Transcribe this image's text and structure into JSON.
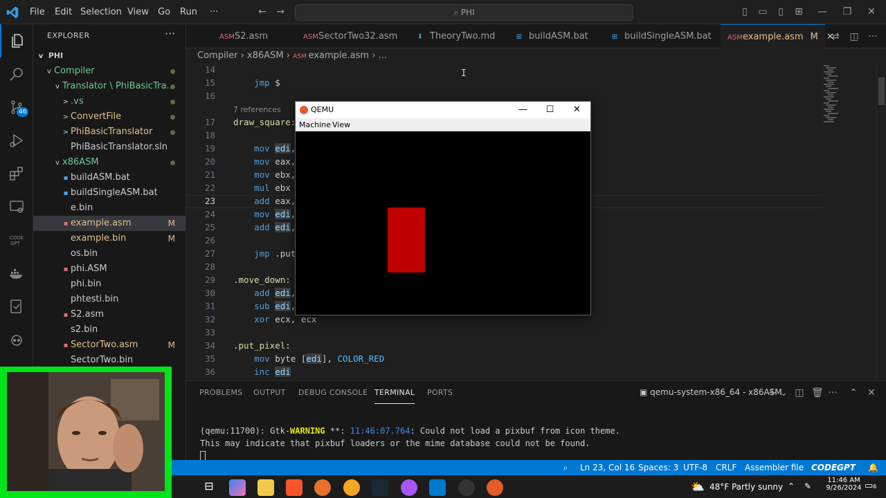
{
  "titlebar": {
    "menus": [
      "File",
      "Edit",
      "Selection",
      "View",
      "Go",
      "Run",
      "···"
    ],
    "search": "PHI"
  },
  "activity": {
    "source_control_badge": "46"
  },
  "explorer": {
    "title": "EXPLORER",
    "root": "PHI",
    "items": [
      {
        "label": "Compiler",
        "color": "#73c991",
        "chev": "v",
        "indent": 0,
        "status": "dot"
      },
      {
        "label": "Translator \\ PhiBasicTra...",
        "color": "#73c991",
        "chev": "v",
        "indent": 1,
        "status": "dot"
      },
      {
        "label": ".vs",
        "color": "#73c991",
        "chev": ">",
        "indent": 2,
        "status": "dot"
      },
      {
        "label": "ConvertFile",
        "color": "#e2c08d",
        "chev": ">",
        "indent": 2,
        "status": "dot"
      },
      {
        "label": "PhiBasicTranslator",
        "color": "#e2c08d",
        "chev": ">",
        "indent": 2,
        "status": "dot"
      },
      {
        "label": "PhiBasicTranslator.sln",
        "color": "#cccccc",
        "chev": "",
        "indent": 2,
        "status": ""
      },
      {
        "label": "x86ASM",
        "color": "#73c991",
        "chev": "v",
        "indent": 1,
        "status": "dot"
      },
      {
        "label": "buildASM.bat",
        "color": "#cccccc",
        "chev": "",
        "indent": 2,
        "status": ""
      },
      {
        "label": "buildSingleASM.bat",
        "color": "#cccccc",
        "chev": "",
        "indent": 2,
        "status": ""
      },
      {
        "label": "e.bin",
        "color": "#cccccc",
        "chev": "",
        "indent": 2,
        "status": ""
      },
      {
        "label": "example.asm",
        "color": "#e2c08d",
        "chev": "",
        "indent": 2,
        "status": "M",
        "selected": true
      },
      {
        "label": "example.bin",
        "color": "#e2c08d",
        "chev": "",
        "indent": 2,
        "status": "M"
      },
      {
        "label": "os.bin",
        "color": "#cccccc",
        "chev": "",
        "indent": 2,
        "status": ""
      },
      {
        "label": "phi.ASM",
        "color": "#cccccc",
        "chev": "",
        "indent": 2,
        "status": ""
      },
      {
        "label": "phi.bin",
        "color": "#cccccc",
        "chev": "",
        "indent": 2,
        "status": ""
      },
      {
        "label": "phtesti.bin",
        "color": "#cccccc",
        "chev": "",
        "indent": 2,
        "status": ""
      },
      {
        "label": "S2.asm",
        "color": "#cccccc",
        "chev": "",
        "indent": 2,
        "status": ""
      },
      {
        "label": "s2.bin",
        "color": "#cccccc",
        "chev": "",
        "indent": 2,
        "status": ""
      },
      {
        "label": "SectorTwo.asm",
        "color": "#e2c08d",
        "chev": "",
        "indent": 2,
        "status": "M"
      },
      {
        "label": "SectorTwo.bin",
        "color": "#cccccc",
        "chev": "",
        "indent": 2,
        "status": ""
      }
    ]
  },
  "tabs": [
    {
      "label": "S2.asm",
      "icon": "asm"
    },
    {
      "label": "SectorTwo32.asm",
      "icon": "asm"
    },
    {
      "label": "TheoryTwo.md",
      "icon": "md"
    },
    {
      "label": "buildASM.bat",
      "icon": "bat"
    },
    {
      "label": "buildSingleASM.bat",
      "icon": "bat"
    },
    {
      "label": "example.asm",
      "icon": "asm",
      "active": true,
      "modified": "M"
    }
  ],
  "breadcrumb": [
    "Compiler",
    "x86ASM",
    "example.asm",
    "..."
  ],
  "editor": {
    "references": "7 references",
    "lines": [
      {
        "n": "14",
        "html": ""
      },
      {
        "n": "15",
        "html": "    <span class='kw'>jmp</span> $"
      },
      {
        "n": "16",
        "html": ""
      },
      {
        "n": "17",
        "html": "<span class='lbl'>draw_square:</span>"
      },
      {
        "n": "18",
        "html": ""
      },
      {
        "n": "19",
        "html": "    <span class='kw'>mov</span> <span class='reg'>edi</span>,"
      },
      {
        "n": "20",
        "html": "    <span class='kw'>mov</span> eax,"
      },
      {
        "n": "21",
        "html": "    <span class='kw'>mov</span> ebx,"
      },
      {
        "n": "22",
        "html": "    <span class='kw'>mul</span> ebx"
      },
      {
        "n": "23",
        "html": "    <span class='kw'>add</span> eax,"
      },
      {
        "n": "24",
        "html": "    <span class='kw'>mov</span> <span class='reg'>edi</span>,"
      },
      {
        "n": "25",
        "html": "    <span class='kw'>add</span> <span class='reg'>edi</span>,"
      },
      {
        "n": "26",
        "html": ""
      },
      {
        "n": "27",
        "html": "    <span class='kw'>jmp</span> .put_"
      },
      {
        "n": "28",
        "html": ""
      },
      {
        "n": "29",
        "html": "<span class='lbl'>.move_down:</span>"
      },
      {
        "n": "30",
        "html": "    <span class='kw'>add</span> <span class='reg'>edi</span>,"
      },
      {
        "n": "31",
        "html": "    <span class='kw'>sub</span> <span class='reg'>edi</span>,"
      },
      {
        "n": "32",
        "html": "    <span class='kw'>xor</span> ecx, ecx"
      },
      {
        "n": "33",
        "html": ""
      },
      {
        "n": "34",
        "html": "<span class='lbl'>.put_pixel:</span>"
      },
      {
        "n": "35",
        "html": "    <span class='kw'>mov</span> byte [<span class='reg'>edi</span>], <span class='const'>COLOR_RED</span>"
      },
      {
        "n": "36",
        "html": "    <span class='kw'>inc</span> <span class='reg'>edi</span>"
      }
    ]
  },
  "qemu": {
    "title": "QEMU",
    "menus": [
      "Machine",
      "View"
    ],
    "square_color": "#c00000"
  },
  "panel": {
    "tabs": [
      "PROBLEMS",
      "OUTPUT",
      "DEBUG CONSOLE",
      "TERMINAL",
      "PORTS"
    ],
    "active_tab": "TERMINAL",
    "terminal_name": "qemu-system-x86_64 - x86ASM",
    "term_prefix": "(qemu:11700): Gtk-",
    "term_warn": "WARNING",
    "term_mid": " **: ",
    "term_time": "11:46:07.764",
    "term_rest": ": Could not load a pixbuf from icon theme.",
    "term_line2": "This may indicate that pixbuf loaders or the mime database could not be found."
  },
  "status": {
    "position": "Ln 23, Col 16",
    "spaces": "Spaces: 3",
    "encoding": "UTF-8",
    "eol": "CRLF",
    "language": "Assembler file",
    "codegpt": "CODEGPT"
  },
  "taskbar": {
    "weather": "48°F  Partly sunny",
    "time": "11:46 AM",
    "date": "9/26/2024",
    "notifications": "6"
  },
  "colors": {
    "accent": "#0078d4",
    "webcam_border": "#00e51a"
  }
}
